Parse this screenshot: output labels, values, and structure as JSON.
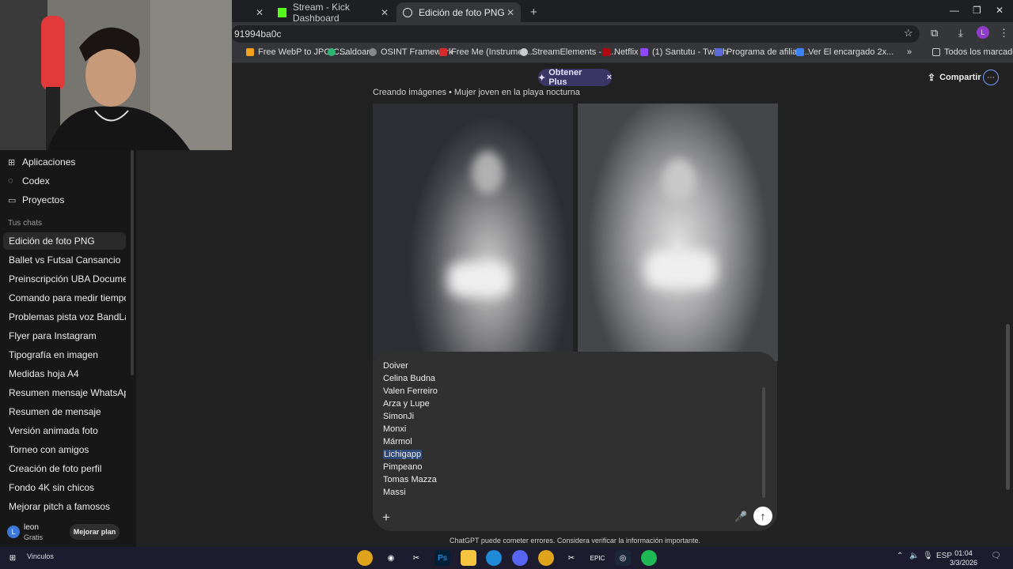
{
  "browser": {
    "tabs": [
      {
        "label": "Stream - Kick Dashboard",
        "active": false
      },
      {
        "label": "Edición de foto PNG",
        "active": true
      }
    ],
    "url": "91994ba0c",
    "bookmarks": [
      "Free WebP to JPG C...",
      "Saldoar",
      "OSINT Framework",
      "Free Me (Instrumen...",
      "StreamElements - II...",
      "Netflix",
      "(1) Santutu - Twitch",
      "Programa de afiliad...",
      "Ver El encargado 2x...",
      "Todos los marcadores"
    ],
    "profile_initial": "L"
  },
  "sidebar": {
    "nav": [
      {
        "label": "Aplicaciones",
        "icon": "grid-icon"
      },
      {
        "label": "Codex",
        "icon": "codex-icon"
      },
      {
        "label": "Proyectos",
        "icon": "folder-icon"
      }
    ],
    "section_title": "Tus chats",
    "chats": [
      "Edición de foto PNG",
      "Ballet vs Futsal Cansancio",
      "Preinscripción UBA Docume...",
      "Comando para medir tiempo",
      "Problemas pista voz BandLab",
      "Flyer para Instagram",
      "Tipografía en imagen",
      "Medidas hoja A4",
      "Resumen mensaje WhatsApp",
      "Resumen de mensaje",
      "Versión animada foto",
      "Torneo con amigos",
      "Creación de foto perfil",
      "Fondo 4K sin chicos",
      "Mejorar pitch a famosos"
    ],
    "user": {
      "initial": "L",
      "name": "leon",
      "plan": "Gratis",
      "upgrade_label": "Mejorar plan"
    }
  },
  "header": {
    "get_plus_label": "Obtener Plus",
    "share_label": "Compartir"
  },
  "conversation": {
    "status_line": "Creando imágenes • Mujer joven en la playa nocturna"
  },
  "composer": {
    "names": [
      "Doiver",
      "Celina Budna",
      "Valen Ferreiro",
      "Arza y Lupe",
      "SimonJi",
      "Monxi",
      "Mármol",
      "Lichigapp",
      "Pimpeano",
      "Tomas Mazza",
      "Massi"
    ],
    "selected": "Lichigapp",
    "disclaimer": "ChatGPT puede cometer errores. Considera verificar la información importante."
  },
  "taskbar": {
    "label": "Vinculos",
    "lang": "ESP",
    "time": "01:04",
    "date": "3/3/2026"
  },
  "colors": {
    "accent": "#6f9cff",
    "plus_bg": "#3b3565",
    "selection": "#2d4a7a"
  }
}
